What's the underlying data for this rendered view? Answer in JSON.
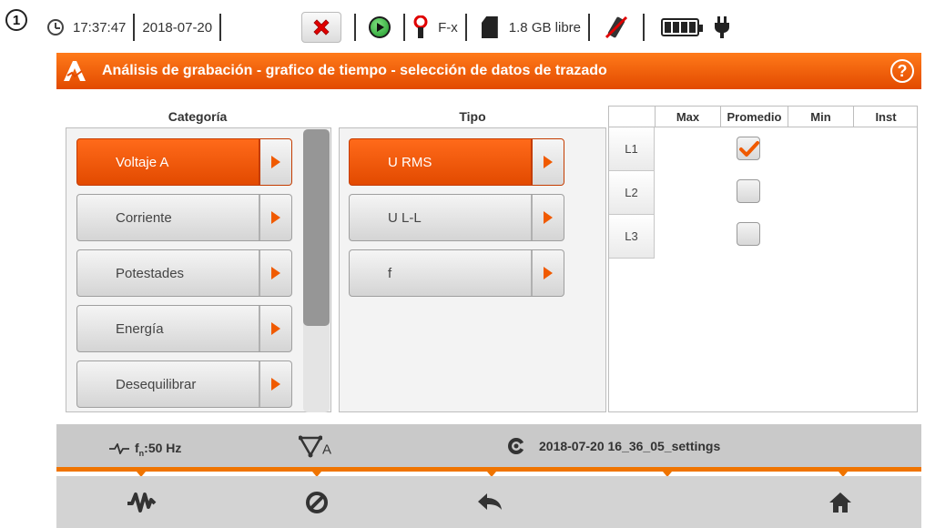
{
  "callout": "1",
  "status": {
    "time": "17:37:47",
    "date": "2018-07-20",
    "clamp": "F-x",
    "memory": "1.8 GB libre"
  },
  "title": "Análisis de grabación - grafico de tiempo - selección de datos de trazado",
  "columns": {
    "categoria": "Categoría",
    "tipo": "Tipo"
  },
  "categories": [
    "Voltaje A",
    "Corriente",
    "Potestades",
    "Energía",
    "Desequilibrar"
  ],
  "selected_category": "Voltaje A",
  "types": [
    "U RMS",
    "U L-L",
    "f"
  ],
  "selected_type": "U RMS",
  "grid": {
    "headers": [
      "Max",
      "Promedio",
      "Min",
      "Inst"
    ],
    "rows": [
      "L1",
      "L2",
      "L3"
    ],
    "checked": {
      "L1": [
        "Promedio"
      ],
      "L2": [],
      "L3": []
    }
  },
  "info": {
    "frequency": "f",
    "frequency_sub": "n",
    "frequency_value": ":50 Hz",
    "vector_label": "A",
    "settings": "2018-07-20 16_36_05_settings"
  },
  "colors": {
    "accent": "#f07400",
    "selected": "#e24a00"
  }
}
